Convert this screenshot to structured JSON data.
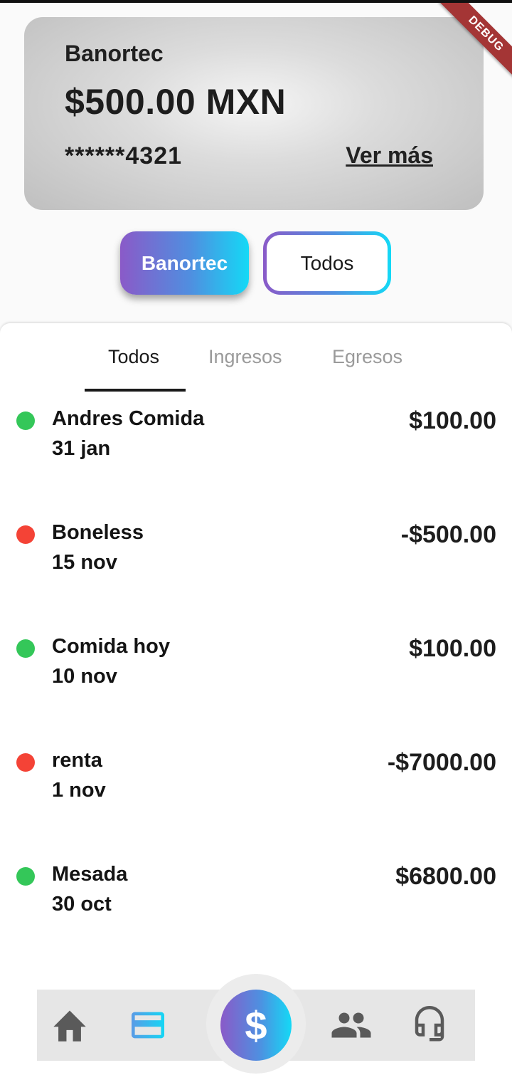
{
  "debug_banner": "DEBUG",
  "account_card": {
    "bank_name": "Banortec",
    "balance": "$500.00 MXN",
    "account_number": "******4321",
    "see_more": "Ver más"
  },
  "filter_chips": {
    "selected": "Banortec",
    "other": "Todos"
  },
  "tabs": [
    "Todos",
    "Ingresos",
    "Egresos"
  ],
  "active_tab": "Todos",
  "transactions": [
    {
      "name": "Andres Comida",
      "date": "31 jan",
      "amount": "$100.00",
      "type": "income"
    },
    {
      "name": "Boneless",
      "date": "15 nov",
      "amount": "-$500.00",
      "type": "expense"
    },
    {
      "name": "Comida hoy",
      "date": "10 nov",
      "amount": "$100.00",
      "type": "income"
    },
    {
      "name": "renta",
      "date": "1 nov",
      "amount": "-$7000.00",
      "type": "expense"
    },
    {
      "name": "Mesada",
      "date": "30 oct",
      "amount": "$6800.00",
      "type": "income"
    }
  ],
  "colors": {
    "income": "#34c759",
    "expense": "#f44336",
    "gradient_start": "#8a5ac8",
    "gradient_end": "#14d9f6"
  },
  "bottom_nav": {
    "items": [
      "home-icon",
      "card-icon",
      "dollar-icon",
      "people-icon",
      "headset-icon"
    ],
    "center_symbol": "$",
    "active": "dollar-icon"
  }
}
